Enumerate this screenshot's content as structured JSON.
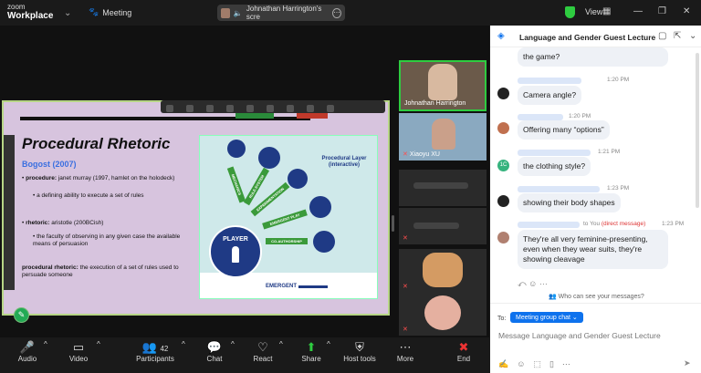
{
  "app": {
    "brand_small": "zoom",
    "brand_main": "Workplace",
    "meeting_label": "Meeting",
    "speaker": "Johnathan Harrington's scre",
    "view_label": "View"
  },
  "slide": {
    "title": "Procedural Rhetoric",
    "author": "Bogost (2007)",
    "b1_head": "procedure:",
    "b1_text": "janet murray (1997, hamlet on the holodeck)",
    "b1_sub": "a defining ability to execute a set of rules",
    "b2_head": "rhetoric:",
    "b2_text": "aristotle (200BCish)",
    "b2_sub": "the faculty of observing in any given case the available means of persuasion",
    "b3_head": "procedural rhetoric:",
    "b3_text": "the execution of a set of rules used to persuade someone",
    "diagram": {
      "layer": "Procedural Layer (interactive)",
      "player": "PLAYER",
      "emergent": "EMERGENT",
      "a1": "RULE-SYSTEM",
      "a2": "EXPERIMENTATION",
      "a3": "EMERGENT PLAY",
      "a4": "CO-AUTHORSHIP",
      "a5": "MECHANICS"
    }
  },
  "participants": [
    {
      "name": "Johnathan Harrington"
    },
    {
      "name": "Xiaoyu XU"
    }
  ],
  "toolbar": {
    "audio": "Audio",
    "video": "Video",
    "participants": "Participants",
    "participant_count": "42",
    "chat": "Chat",
    "react": "React",
    "share": "Share",
    "host_tools": "Host tools",
    "more": "More",
    "end": "End"
  },
  "chat": {
    "title": "Language and Gender Guest Lecture",
    "messages": [
      {
        "time": "",
        "text": "the game?"
      },
      {
        "time": "1:20 PM",
        "text": "Camera angle?"
      },
      {
        "time": "1:20 PM",
        "text": "Offering many “options”"
      },
      {
        "time": "1:21 PM",
        "text": "the clothing style?"
      },
      {
        "time": "1:23 PM",
        "text": "showing their body shapes"
      },
      {
        "time": "1:23 PM",
        "to": "to You",
        "dm": "(direct message)",
        "text": "They're all very feminine-presenting, even when they wear suits, they're showing cleavage"
      }
    ],
    "avatar_initials": "1C",
    "who_can_see": "Who can see your messages?",
    "to_label": "To:",
    "to_value": "Meeting group chat",
    "placeholder": "Message Language and Gender Guest Lecture"
  }
}
